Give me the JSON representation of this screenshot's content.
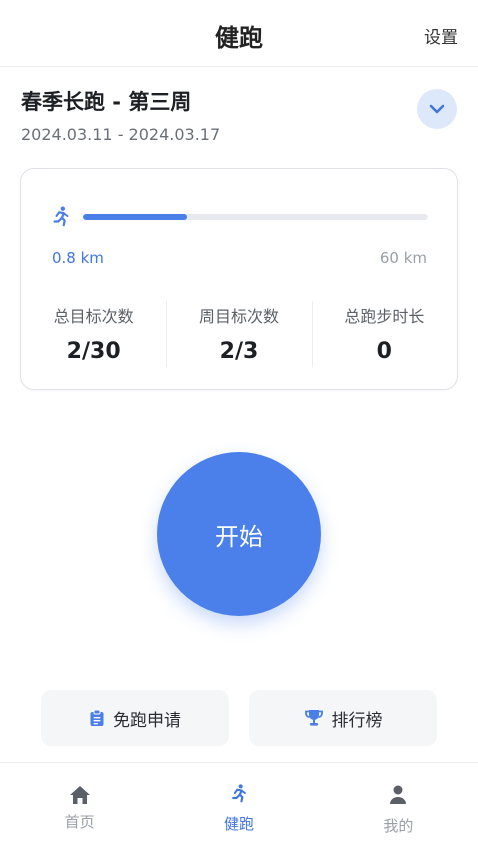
{
  "header": {
    "title": "健跑",
    "settings_label": "设置"
  },
  "plan": {
    "title": "春季长跑 - 第三周",
    "dates": "2024.03.11 - 2024.03.17",
    "toggle_icon": "chevron-down-icon"
  },
  "progress": {
    "current_label": "0.8 km",
    "total_label": "60 km",
    "fill_fraction": 0.3,
    "accent": "#4a7fe8"
  },
  "stats": [
    {
      "label": "总目标次数",
      "value": "2/30"
    },
    {
      "label": "周目标次数",
      "value": "2/3"
    },
    {
      "label": "总跑步时长",
      "value": "0"
    }
  ],
  "start_button": {
    "label": "开始",
    "color": "#4b80ea"
  },
  "actions": {
    "exempt": {
      "label": "免跑申请",
      "icon": "clipboard-icon"
    },
    "rank": {
      "label": "排行榜",
      "icon": "trophy-icon"
    }
  },
  "nav": [
    {
      "label": "首页",
      "icon": "home-icon",
      "active": false
    },
    {
      "label": "健跑",
      "icon": "runner-icon",
      "active": true
    },
    {
      "label": "我的",
      "icon": "person-icon",
      "active": false
    }
  ]
}
